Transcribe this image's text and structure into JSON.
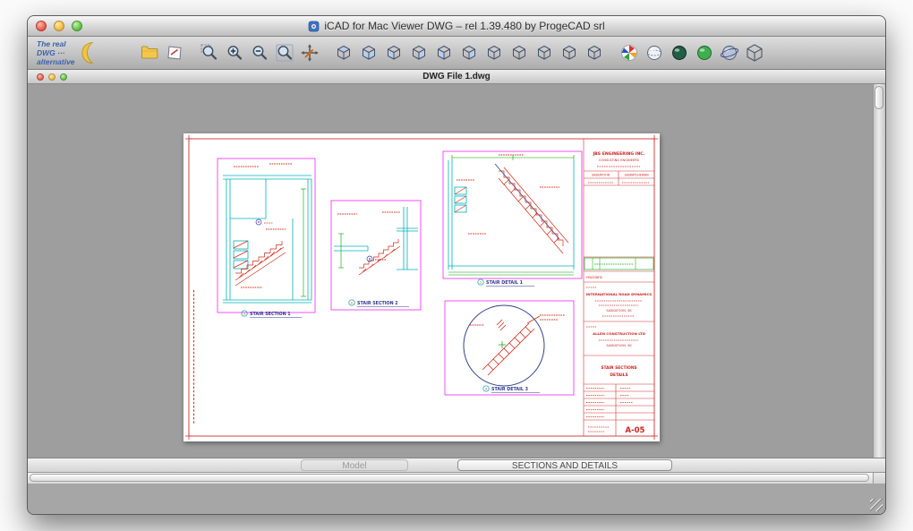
{
  "window": {
    "title": "iCAD for Mac Viewer DWG – rel 1.39.480 by ProgeCAD srl"
  },
  "branding": {
    "line1": "The real",
    "line2": "DWG ···",
    "line3": "alternative"
  },
  "toolbar": {
    "icons": [
      {
        "name": "open-folder-icon",
        "type": "folder"
      },
      {
        "name": "plot-icon",
        "type": "plot"
      },
      {
        "name": "zoom-window-icon",
        "type": "zoom-window",
        "gap": true
      },
      {
        "name": "zoom-in-icon",
        "type": "zoom-in"
      },
      {
        "name": "zoom-out-icon",
        "type": "zoom-out"
      },
      {
        "name": "zoom-extents-icon",
        "type": "zoom-extents"
      },
      {
        "name": "pan-icon",
        "type": "pan"
      },
      {
        "name": "top-view-icon",
        "type": "cube-top",
        "gap": true
      },
      {
        "name": "bottom-view-icon",
        "type": "cube-bottom"
      },
      {
        "name": "left-view-icon",
        "type": "cube-left"
      },
      {
        "name": "right-view-icon",
        "type": "cube-right"
      },
      {
        "name": "front-view-icon",
        "type": "cube-front"
      },
      {
        "name": "back-view-icon",
        "type": "cube-back"
      },
      {
        "name": "sw-isometric-view-icon",
        "type": "cube-iso"
      },
      {
        "name": "se-isometric-view-icon",
        "type": "cube-iso"
      },
      {
        "name": "ne-isometric-view-icon",
        "type": "cube-iso"
      },
      {
        "name": "nw-isometric-view-icon",
        "type": "cube-iso"
      },
      {
        "name": "named-views-icon",
        "type": "cube-iso"
      },
      {
        "name": "render-icon",
        "type": "render",
        "gap": true
      },
      {
        "name": "wireframe-icon",
        "type": "sphere-wire"
      },
      {
        "name": "hidden-line-icon",
        "type": "sphere-dark"
      },
      {
        "name": "shaded-icon",
        "type": "sphere-green"
      },
      {
        "name": "orbit-icon",
        "type": "sphere-orbit"
      },
      {
        "name": "3d-box-icon",
        "type": "box3d"
      }
    ]
  },
  "doc": {
    "title": "DWG File 1.dwg"
  },
  "tabs": [
    {
      "label": "Model",
      "active": false
    },
    {
      "label": "SECTIONS AND DETAILS",
      "active": true
    }
  ],
  "drawing": {
    "captions": {
      "section1": {
        "num": "1",
        "label": "STAIR SECTION 1"
      },
      "section2": {
        "num": "2",
        "label": "STAIR SECTION 2"
      },
      "detail1": {
        "num": "1",
        "label": "STAIR DETAIL 1"
      },
      "detail3": {
        "num": "3",
        "label": "STAIR DETAIL 3"
      }
    },
    "title_block": {
      "company": "JBS ENGINEERING INC.",
      "company_sub": "CONSULTING ENGINEERS",
      "company_city": "SASKATOON",
      "company_region": "SASKATCHEWAN",
      "revisions_label": "revisions",
      "project": "INTERNATIONAL ROAD DYNAMICS",
      "project_city": "SASKATOON, SK",
      "client": "ALLEN CONSTRUCTION LTD",
      "client_city": "SASKATOON, SK",
      "sheet_title_line1": "STAIR SECTIONS",
      "sheet_title_line2": "DETAILS",
      "sheet_number": "A-05"
    }
  },
  "colors": {
    "cad_magenta": "#f040f0",
    "cad_red": "#d42818",
    "cad_cyan": "#00b0b8",
    "cad_green": "#00a000",
    "cad_navy": "#334488",
    "paper": "#ffffff",
    "canvas": "#9e9e9e"
  }
}
